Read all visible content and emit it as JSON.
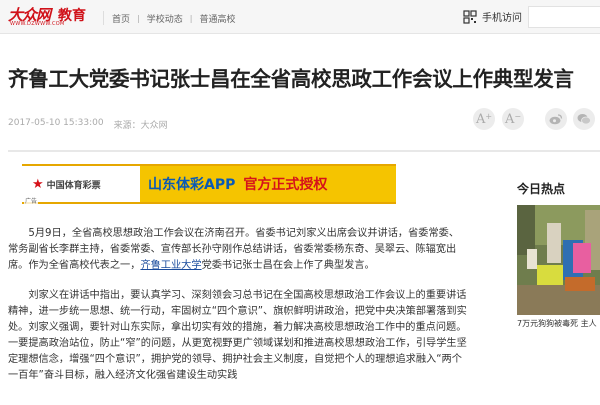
{
  "site": {
    "brand": "大众网",
    "domain": "WWW.DZWWW.COM",
    "section": "教育"
  },
  "breadcrumb": [
    "首页",
    "学校动态",
    "普通高校"
  ],
  "header": {
    "mobile_visit": "手机访问"
  },
  "article": {
    "title": "齐鲁工大党委书记张士昌在全省高校思政工作会议上作典型发言",
    "date": "2017-05-10 15:33:00",
    "source": "来源：大众网",
    "paragraphs": [
      {
        "pre": "5月9日，全省高校思想政治工作会议在济南召开。省委书记刘家义出席会议并讲话，省委常委、常务副省长李群主持，省委常委、宣传部长孙守刚作总结讲话，省委常委杨东奇、吴翠云、陈辐宽出席。作为全省高校代表之一，",
        "link": "齐鲁工业大学",
        "post": "党委书记张士昌在会上作了典型发言。"
      },
      {
        "pre": "刘家义在讲话中指出，要认真学习、深刻领会习总书记在全国高校思想政治工作会议上的重要讲话精神，进一步统一思想、统一行动，牢固树立“四个意识”、旗帜鲜明讲政治，把党中央决策部署落到实处。刘家义强调，要针对山东实际，拿出切实有效的措施，着力解决高校思想政治工作中的重点问题。一要提高政治站位，防止“窄”的问题，从更宽视野更广领域谋划和推进高校思想政治工作，引导学生坚定理想信念，增强“四个意识”，拥护党的领导、拥护社会主义制度，自觉把个人的理想追求融入“两个一百年”奋斗目标，融入经济文化强省建设生动实践",
        "link": "",
        "post": ""
      }
    ]
  },
  "ad": {
    "brand": "中国体育彩票",
    "part1": "山东体彩APP",
    "part2": "官方正式授权",
    "tag": "广告"
  },
  "sidebar": {
    "title": "今日热点",
    "caption": "7万元狗狗被毒死 主人"
  },
  "tools": {
    "font_larger": "A",
    "font_smaller": "A"
  },
  "colors": {
    "brand_red": "#d0121a",
    "ad_yellow": "#f5c400",
    "link_blue": "#1a4b9c"
  }
}
